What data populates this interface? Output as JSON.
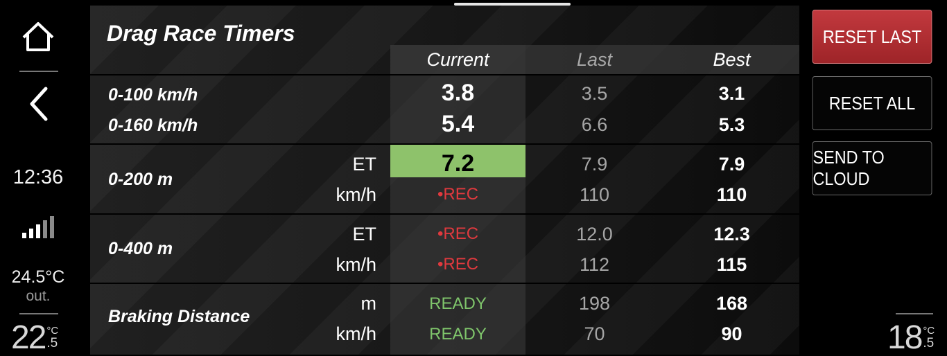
{
  "left_rail": {
    "clock": "12:36",
    "outside_temp": "24.5°C",
    "outside_label": "out.",
    "driver_temp": {
      "whole": "22",
      "unit": "°C",
      "decimal": ".5"
    }
  },
  "right_rail": {
    "passenger_temp": {
      "whole": "18",
      "unit": "°C",
      "decimal": ".5"
    }
  },
  "title": "Drag Race Timers",
  "columns": {
    "current": "Current",
    "last": "Last",
    "best": "Best"
  },
  "rows": {
    "r100": {
      "label": "0-100 km/h",
      "current": "3.8",
      "last": "3.5",
      "best": "3.1"
    },
    "r160": {
      "label": "0-160 km/h",
      "current": "5.4",
      "last": "6.6",
      "best": "5.3"
    },
    "r200": {
      "label": "0-200 m",
      "et": {
        "unit": "ET",
        "current": "7.2",
        "last": "7.9",
        "best": "7.9"
      },
      "speed": {
        "unit": "km/h",
        "current": "•REC",
        "last": "110",
        "best": "110"
      }
    },
    "r400": {
      "label": "0-400 m",
      "et": {
        "unit": "ET",
        "current": "•REC",
        "last": "12.0",
        "best": "12.3"
      },
      "speed": {
        "unit": "km/h",
        "current": "•REC",
        "last": "112",
        "best": "115"
      }
    },
    "braking": {
      "label": "Braking Distance",
      "dist": {
        "unit": "m",
        "current": "READY",
        "last": "198",
        "best": "168"
      },
      "speed": {
        "unit": "km/h",
        "current": "READY",
        "last": "70",
        "best": "90"
      }
    }
  },
  "buttons": {
    "reset_last": "RESET LAST",
    "reset_all": "RESET ALL",
    "send_to_cloud": "SEND TO CLOUD"
  },
  "colors": {
    "highlight": "#8ec26b",
    "rec": "#e0393e",
    "ready": "#7fc56b",
    "reset_last": "#b3302f"
  },
  "icons": [
    "home-icon",
    "back-icon",
    "signal-strength-icon"
  ]
}
